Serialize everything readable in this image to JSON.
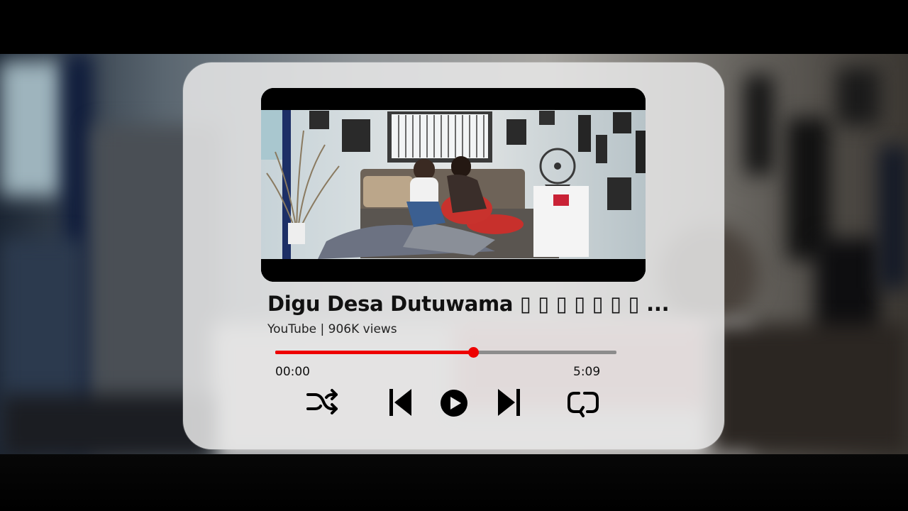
{
  "video": {
    "title": "Digu Desa Dutuwama ▯ ▯ ▯ ▯ ▯ ▯ ▯ ...",
    "meta": "YouTube | 906K views"
  },
  "playback": {
    "current_time": "00:00",
    "total_time": "5:09",
    "progress_fraction": 0.58
  },
  "controls": {
    "shuffle": "shuffle-icon",
    "previous": "skip-previous-icon",
    "play": "play-icon",
    "next": "skip-next-icon",
    "repeat": "repeat-icon"
  },
  "colors": {
    "progress_played": "#ee0000",
    "progress_track": "#8c8c8c",
    "card_background": "#e8e8e8"
  }
}
